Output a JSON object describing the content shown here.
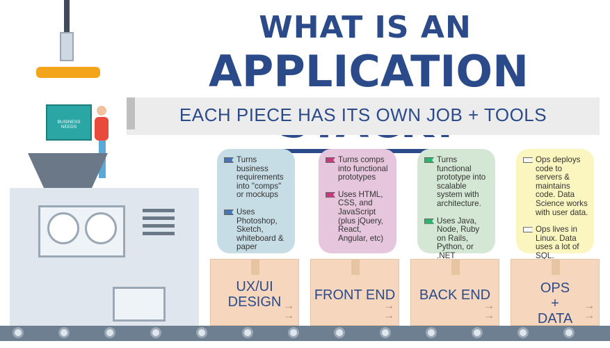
{
  "title": {
    "line1": "WHAT IS AN",
    "line2_word1": "APPLICATION",
    "line2_word2": "STACK?",
    "subtitle": "EACH PIECE HAS ITS OWN JOB + TOOLS"
  },
  "illustration": {
    "box_label_line1": "BUSINESS",
    "box_label_line2": "NEEDS"
  },
  "columns": [
    {
      "color": "#c7dde6",
      "flag_color": "#4a73b6",
      "items": [
        "Turns business requirements into \"comps\" or mockups",
        "Uses Photoshop, Sketch, whiteboard & paper"
      ],
      "box_label": "UX/UI DESIGN"
    },
    {
      "color": "#e5c6dc",
      "flag_color": "#c43a7d",
      "items": [
        "Turns comps into functional prototypes",
        "Uses HTML, CSS, and JavaScript (plus jQuery, React, Angular, etc)"
      ],
      "box_label": "FRONT END"
    },
    {
      "color": "#d4e7d4",
      "flag_color": "#2db56f",
      "items": [
        "Turns functional prototype into scalable system with architecture.",
        "Uses Java, Node, Ruby on Rails, Python, or .NET"
      ],
      "box_label": "BACK END"
    },
    {
      "color": "#fbf6bf",
      "flag_color": "#f7f7f7",
      "items": [
        "Ops deploys code to servers & maintains code. Data Science works with user data.",
        "Ops lives in Linux. Data uses a lot of SQL."
      ],
      "box_label_lines": [
        "OPS",
        "+",
        "DATA"
      ]
    }
  ],
  "arrows": "→"
}
